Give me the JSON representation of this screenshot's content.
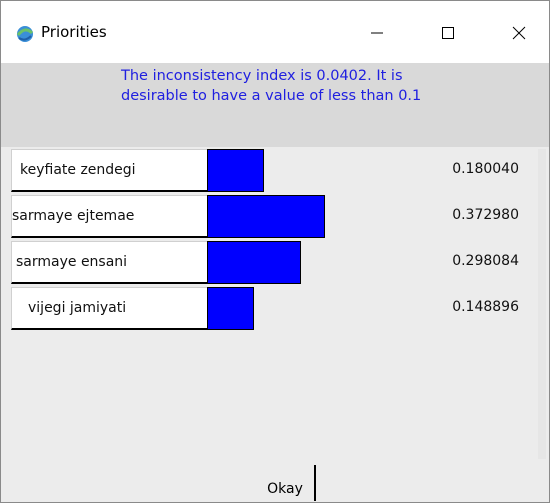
{
  "window": {
    "title": "Priorities"
  },
  "message": {
    "text": "The inconsistency index is 0.0402.  It is desirable to have a value of less than 0.1"
  },
  "priorities": [
    {
      "label": "keyfiate zendegi",
      "value": "0.180040",
      "weight": 0.18004
    },
    {
      "label": "sarmaye ejtemae",
      "value": "0.372980",
      "weight": 0.37298
    },
    {
      "label": "sarmaye ensani",
      "value": "0.298084",
      "weight": 0.298084
    },
    {
      "label": "vijegi jamiyati",
      "value": "0.148896",
      "weight": 0.148896
    }
  ],
  "footer": {
    "okay_label": "Okay"
  },
  "colors": {
    "bar": "#0000ff",
    "message_text": "#2020e0"
  },
  "icons": [
    "app-icon",
    "minimize-icon",
    "maximize-icon",
    "close-icon"
  ]
}
